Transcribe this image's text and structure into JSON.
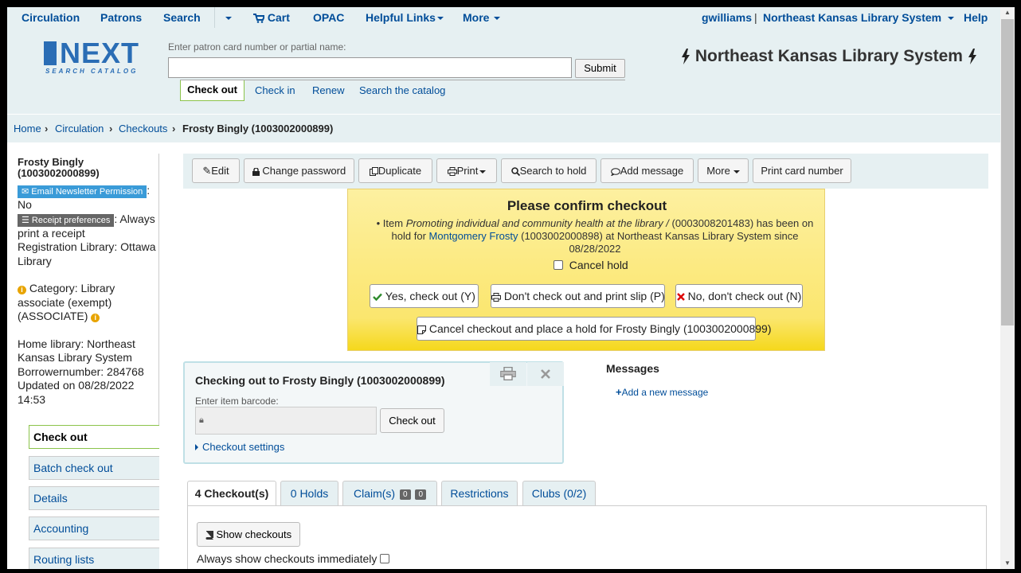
{
  "topnav": {
    "circulation": "Circulation",
    "patrons": "Patrons",
    "search": "Search",
    "cart": "Cart",
    "opac": "OPAC",
    "helpful_links": "Helpful Links",
    "more": "More",
    "user": "gwilliams",
    "user_sep": "|",
    "library": "Northeast Kansas Library System",
    "help": "Help"
  },
  "header": {
    "logo_word": "NEXT",
    "logo_sub": "SEARCH CATALOG",
    "search_label": "Enter patron card number or partial name:",
    "search_value": "",
    "submit": "Submit",
    "tabs": [
      "Check out",
      "Check in",
      "Renew",
      "Search the catalog"
    ],
    "library_title": "Northeast Kansas Library System"
  },
  "breadcrumb": [
    "Home",
    "Circulation",
    "Checkouts",
    "Frosty Bingly (1003002000899)"
  ],
  "patron": {
    "name": "Frosty Bingly (1003002000899)",
    "email_badge": "Email Newsletter Permission",
    "email_value": ": No",
    "receipt_badge": "Receipt preferences",
    "receipt_value": ": Always print a receipt",
    "registration": "Registration Library: Ottawa Library",
    "category": "Category: Library associate (exempt) (ASSOCIATE)",
    "home_library": "Home library: Northeast Kansas Library System",
    "borrowernumber": "Borrowernumber: 284768",
    "updated": "Updated on 08/28/2022 14:53"
  },
  "leftmenu": [
    "Check out",
    "Batch check out",
    "Details",
    "Accounting",
    "Routing lists"
  ],
  "toolbar": [
    "Edit",
    "Change password",
    "Duplicate",
    "Print",
    "Search to hold",
    "Add message",
    "More",
    "Print card number"
  ],
  "confirm": {
    "title": "Please confirm checkout",
    "msg_prefix": "• Item ",
    "item_title": "Promoting individual and community health at the library /",
    "msg_middle": " (0003008201483) has been on hold for ",
    "hold_patron": "Montgomery Frosty",
    "msg_suffix": " (1003002000898) at Northeast Kansas Library System since 08/28/2022",
    "cancel_hold": "Cancel hold",
    "yes": "Yes, check out (Y)",
    "print_slip": "Don't check out and print slip (P)",
    "no": "No, don't check out (N)",
    "cancel_place_hold": "Cancel checkout and place a hold for Frosty Bingly (1003002000899)"
  },
  "checkout": {
    "title": "Checking out to Frosty Bingly (1003002000899)",
    "barcode_label": "Enter item barcode:",
    "barcode_value": "",
    "button": "Check out",
    "settings": "Checkout settings"
  },
  "messages": {
    "heading": "Messages",
    "add": "Add a new message"
  },
  "tabs": {
    "checkouts": "4 Checkout(s)",
    "holds": "0 Holds",
    "claims": "Claim(s)",
    "claims_a": "0",
    "claims_b": "0",
    "restrictions": "Restrictions",
    "clubs": "Clubs (0/2)"
  },
  "pane": {
    "show_checkouts": "Show checkouts",
    "always_show": "Always show checkouts immediately"
  },
  "colors": {
    "link": "#004d99",
    "nav_bg": "#e6f0f2",
    "confirm_bg": "#fbe66e",
    "accent_green": "#8bc34a"
  }
}
